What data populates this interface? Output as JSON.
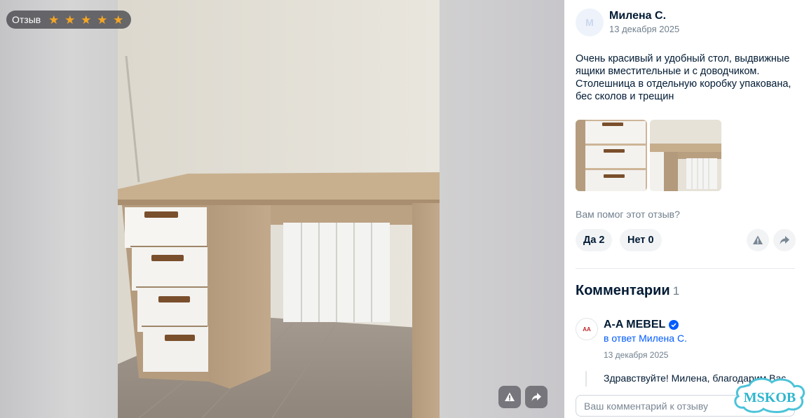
{
  "viewer": {
    "badge_label": "Отзыв",
    "rating": 5,
    "star_icon": "star-icon",
    "complain_icon": "warning-icon",
    "share_icon": "share-arrow-icon"
  },
  "review": {
    "author": "Милена С.",
    "avatar_letter": "M",
    "date": "13 декабря 2025",
    "text": "Очень красивый и удобный стол, выдвижные ящики вместительные и с доводчиком. Столешница в отдельную коробку упакована, бес сколов и трещин",
    "helpful_question": "Вам помог этот отзыв?",
    "yes_label": "Да",
    "yes_count": "2",
    "no_label": "Нет",
    "no_count": "0"
  },
  "comments": {
    "title": "Комментарии",
    "count": "1",
    "items": [
      {
        "seller_name": "A-A MEBEL",
        "logo_text": "AA",
        "reply_to": "в ответ Милена С.",
        "date": "13 декабря 2025",
        "text": "Здравствуйте! Милена, благодарим Вас"
      }
    ],
    "input_placeholder": "Ваш комментарий к отзыву"
  },
  "watermark": {
    "text": "MSKOB"
  },
  "colors": {
    "accent": "#005bff",
    "star": "#f5a623",
    "text": "#001a34",
    "muted": "#707f8d"
  }
}
